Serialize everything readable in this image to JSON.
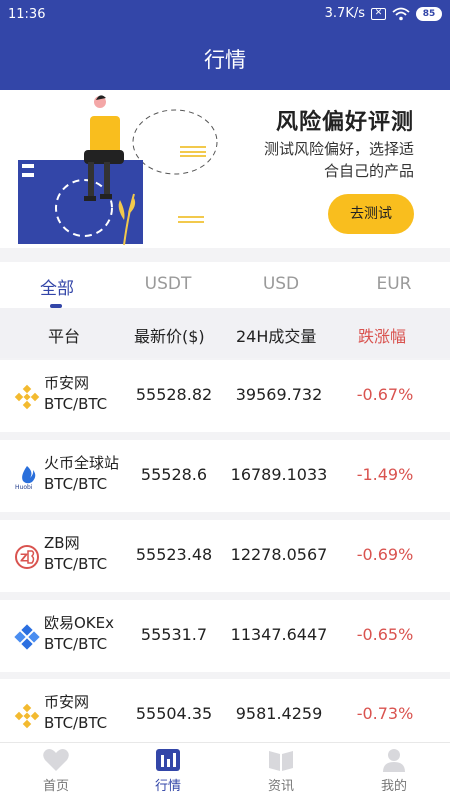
{
  "status": {
    "time": "11:36",
    "speed": "3.7K/s",
    "battery": "85"
  },
  "header": {
    "title": "行情"
  },
  "banner": {
    "title": "风险偏好评测",
    "subtitle": "测试风险偏好，选择适合自己的产品",
    "button": "去测试"
  },
  "tabs": [
    "全部",
    "USDT",
    "USD",
    "EUR"
  ],
  "table": {
    "headers": [
      "平台",
      "最新价($)",
      "24H成交量",
      "跌涨幅"
    ],
    "rows": [
      {
        "name": "币安网",
        "pair": "BTC/BTC",
        "price": "55528.82",
        "volume": "39569.732",
        "change": "-0.67%",
        "logo": "binance-icon"
      },
      {
        "name": "火币全球站",
        "pair": "BTC/BTC",
        "price": "55528.6",
        "volume": "16789.1033",
        "change": "-1.49%",
        "logo": "huobi-icon"
      },
      {
        "name": "ZB网",
        "pair": "BTC/BTC",
        "price": "55523.48",
        "volume": "12278.0567",
        "change": "-0.69%",
        "logo": "zb-icon"
      },
      {
        "name": "欧易OKEx",
        "pair": "BTC/BTC",
        "price": "55531.7",
        "volume": "11347.6447",
        "change": "-0.65%",
        "logo": "okex-icon"
      },
      {
        "name": "币安网",
        "pair": "BTC/BTC",
        "price": "55504.35",
        "volume": "9581.4259",
        "change": "-0.73%",
        "logo": "binance-icon"
      }
    ]
  },
  "nav": [
    "首页",
    "行情",
    "资讯",
    "我的"
  ],
  "colors": {
    "primary": "#3346a8",
    "accent": "#f9be1e",
    "down": "#d9534f"
  }
}
